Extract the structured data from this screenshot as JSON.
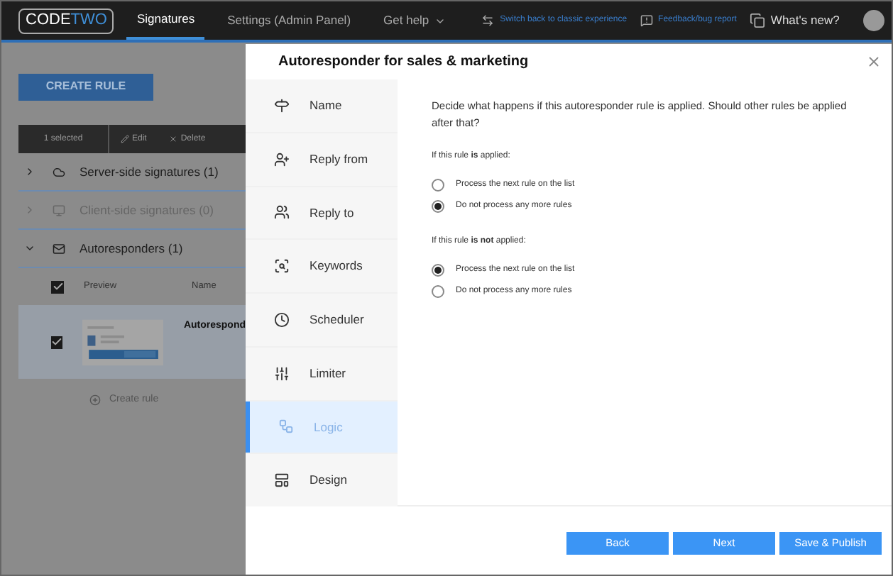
{
  "topbar": {
    "logo": {
      "part_1": "CODE",
      "part_2": "TWO"
    },
    "tabs": [
      {
        "label": "Signatures",
        "selected": true
      },
      {
        "label": "Settings (Admin Panel)",
        "selected": false
      },
      {
        "label": "Get help",
        "selected": false,
        "dropdown": true
      }
    ],
    "links": [
      {
        "kind": "switch",
        "label": "Switch back to classic experience"
      },
      {
        "kind": "feedback",
        "label": "Feedback/bug report"
      },
      {
        "kind": "news",
        "label": "What's new?"
      }
    ]
  },
  "page": {
    "create_button": "CREATE RULE",
    "toolbar": {
      "count": "1 selected",
      "actions": [
        {
          "kind": "edit",
          "label": "Edit"
        },
        {
          "kind": "delete",
          "label": "Delete"
        }
      ]
    },
    "sections": [
      {
        "kind": "cloud",
        "title": "Server-side signatures (1)",
        "expanded": false,
        "disabled": false
      },
      {
        "kind": "monitor",
        "title": "Client-side signatures (0)",
        "expanded": false,
        "disabled": true
      },
      {
        "kind": "mail",
        "title": "Autoresponders (1)",
        "expanded": true,
        "disabled": false
      }
    ],
    "table": {
      "header_checked": true,
      "columns": [
        "Preview",
        "Name"
      ],
      "rows": [
        {
          "checked": true,
          "name": "Autorespond"
        }
      ]
    },
    "create_link": "Create rule"
  },
  "dialog": {
    "title": "Autoresponder for sales & marketing",
    "nav": [
      {
        "label": "Name",
        "selected": false
      },
      {
        "label": "Reply from",
        "selected": false
      },
      {
        "label": "Reply to",
        "selected": false
      },
      {
        "label": "Keywords",
        "selected": false
      },
      {
        "label": "Scheduler",
        "selected": false
      },
      {
        "label": "Limiter",
        "selected": false
      },
      {
        "label": "Logic",
        "selected": true
      },
      {
        "label": "Design",
        "selected": false
      }
    ],
    "description": "Decide what happens if this autoresponder rule is applied. Should other rules be applied after that?",
    "groups": [
      {
        "label": "If this rule **is** applied:",
        "options": [
          {
            "label": "Process the next rule on the list",
            "selected": false
          },
          {
            "label": "Do not process any more rules",
            "selected": true
          }
        ]
      },
      {
        "label": "If this rule **is not** applied:",
        "options": [
          {
            "label": "Process the next rule on the list",
            "selected": true
          },
          {
            "label": "Do not process any more rules",
            "selected": false
          }
        ]
      }
    ],
    "buttons": [
      "Back",
      "Next",
      "Save & Publish"
    ]
  }
}
